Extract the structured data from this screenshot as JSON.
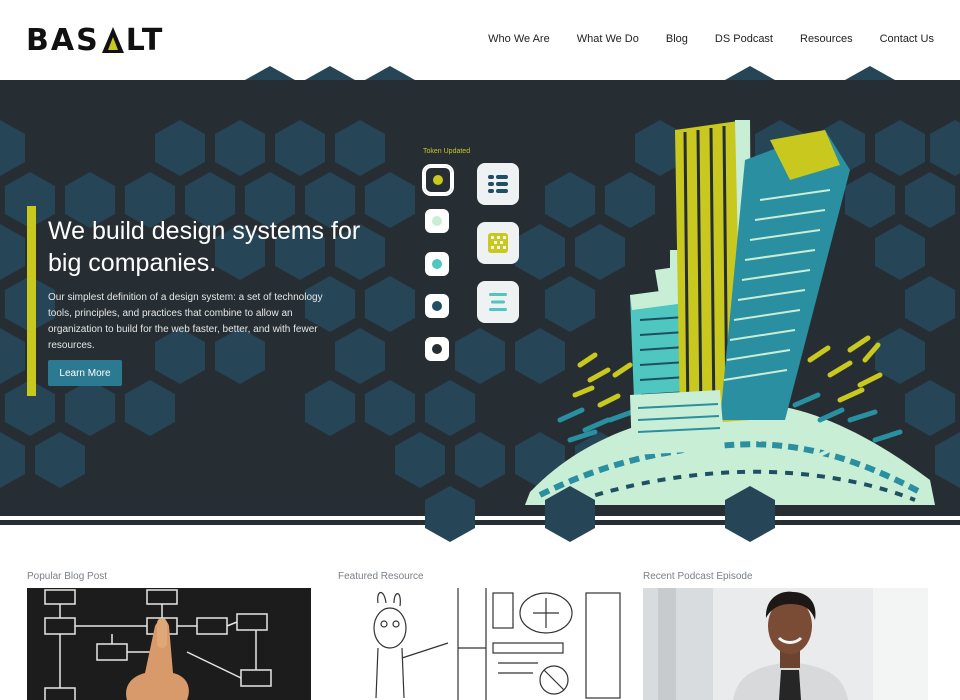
{
  "brand": {
    "name_pre": "BAS",
    "name_post": "LT",
    "logo_accent": "#c8c81e"
  },
  "nav": [
    {
      "label": "Who We Are"
    },
    {
      "label": "What We Do"
    },
    {
      "label": "Blog"
    },
    {
      "label": "DS Podcast"
    },
    {
      "label": "Resources"
    },
    {
      "label": "Contact Us"
    }
  ],
  "hero": {
    "title": "We build design systems for big companies.",
    "description": "Our simplest definition of a design system: a set of technology tools, principles, and practices that combine to allow an organization to build for the web faster, better, and with fewer resources.",
    "cta_label": "Learn More",
    "token_label": "Token Updated",
    "token_colors": [
      "#c8c81e",
      "#c9eed6",
      "#4fc6c0",
      "#1f4f63",
      "#262e33"
    ],
    "component_icons": [
      "list-icon",
      "pattern-icon",
      "menu-icon"
    ]
  },
  "colors": {
    "hero_bg": "#262e33",
    "hex": "#264556",
    "accent": "#c8c81e",
    "button": "#2c7a91"
  },
  "sections": [
    {
      "label": "Popular Blog Post"
    },
    {
      "label": "Featured Resource"
    },
    {
      "label": "Recent Podcast Episode"
    }
  ]
}
